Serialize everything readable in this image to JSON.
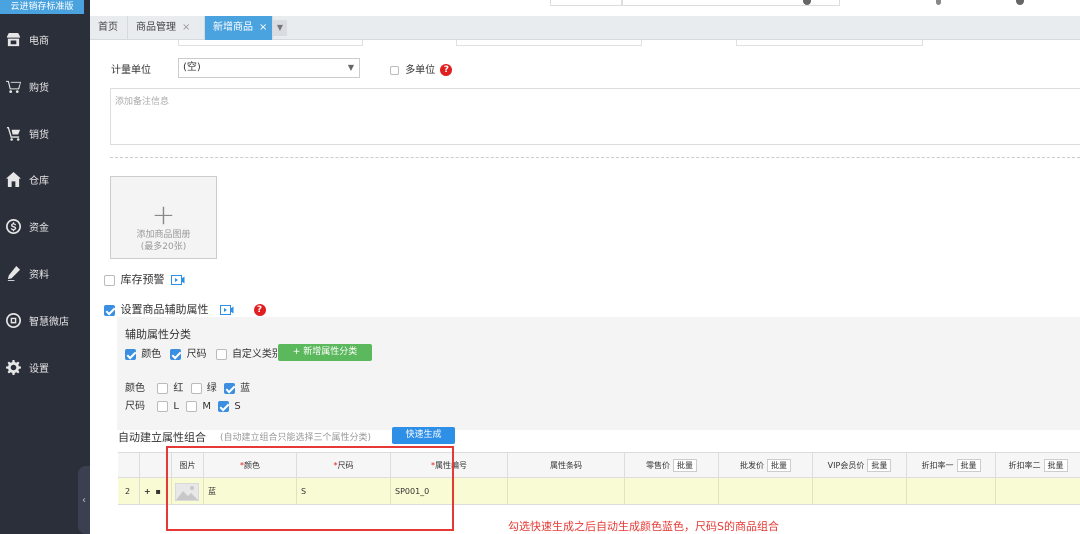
{
  "brand": "云进销存标准版",
  "sidebar": {
    "items": [
      {
        "label": "电商",
        "icon": "store-icon"
      },
      {
        "label": "购货",
        "icon": "cart-icon"
      },
      {
        "label": "销货",
        "icon": "sales-cart-icon"
      },
      {
        "label": "仓库",
        "icon": "warehouse-icon"
      },
      {
        "label": "资金",
        "icon": "dollar-icon"
      },
      {
        "label": "资料",
        "icon": "pen-icon"
      },
      {
        "label": "智慧微店",
        "icon": "microshop-icon"
      },
      {
        "label": "设置",
        "icon": "gear-icon"
      }
    ]
  },
  "tabs": [
    {
      "label": "首页"
    },
    {
      "label": "商品管理",
      "close": "×"
    },
    {
      "label": "新增商品",
      "close": "×"
    }
  ],
  "form": {
    "unit_label": "计量单位",
    "unit_value": "(空)",
    "multi_unit_label": "多单位",
    "remark_placeholder": "添加备注信息",
    "album_line1": "添加商品图册",
    "album_line2": "(最多20张)",
    "stock_alert_label": "库存预警",
    "aux_attr_label": "设置商品辅助属性"
  },
  "attr_panel": {
    "title": "辅助属性分类",
    "categories": [
      {
        "label": "颜色",
        "checked": true
      },
      {
        "label": "尺码",
        "checked": true
      },
      {
        "label": "自定义类别1",
        "checked": false
      }
    ],
    "add_button": "+ 新增属性分类",
    "color_label": "颜色",
    "colors": [
      {
        "label": "红",
        "checked": false
      },
      {
        "label": "绿",
        "checked": false
      },
      {
        "label": "蓝",
        "checked": true
      }
    ],
    "size_label": "尺码",
    "sizes": [
      {
        "label": "L",
        "checked": false
      },
      {
        "label": "M",
        "checked": false
      },
      {
        "label": "S",
        "checked": true
      }
    ]
  },
  "combo": {
    "title": "自动建立属性组合",
    "hint": "(自动建立组合只能选择三个属性分类)",
    "generate_button": "快速生成"
  },
  "table": {
    "headers": {
      "image": "图片",
      "color": "颜色",
      "size": "尺码",
      "sku": "属性编号",
      "barcode": "属性条码",
      "retail": "零售价",
      "wholesale": "批发价",
      "vip": "VIP会员价",
      "discount1": "折扣率一",
      "discount2": "折扣率二"
    },
    "batch_label": "批量",
    "row": {
      "index": "2",
      "color": "蓝",
      "size": "S",
      "sku": "SP001_0"
    }
  },
  "annotation": "勾选快速生成之后自动生成颜色蓝色，尺码S的商品组合"
}
